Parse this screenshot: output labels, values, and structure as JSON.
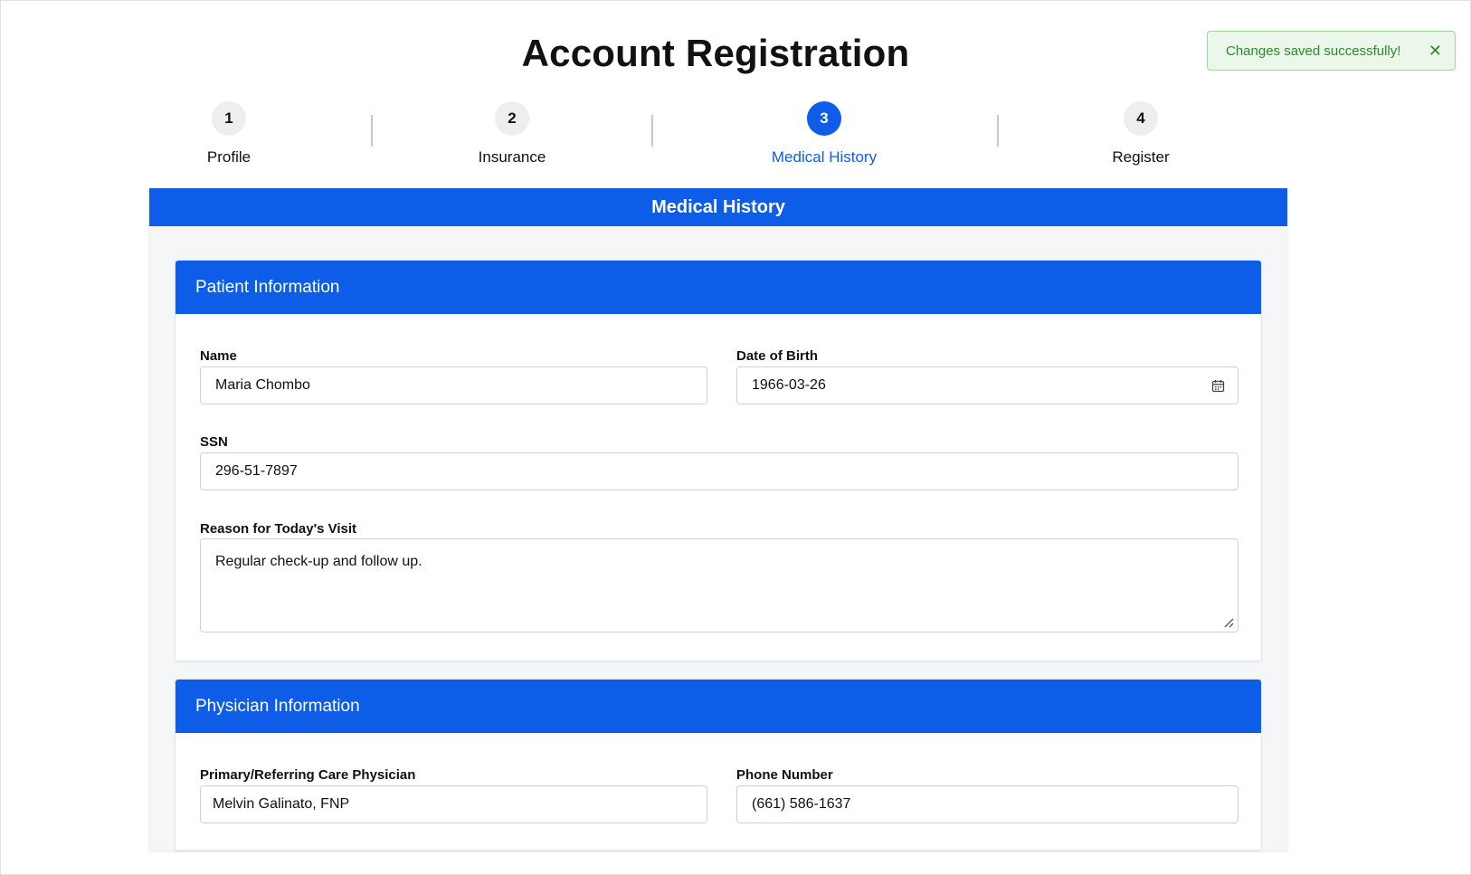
{
  "page": {
    "title": "Account Registration"
  },
  "toast": {
    "message": "Changes saved successfully!",
    "close_icon": "close-icon",
    "color": "#2c8a2c"
  },
  "steps": [
    {
      "number": "1",
      "label": "Profile",
      "active": false
    },
    {
      "number": "2",
      "label": "Insurance",
      "active": false
    },
    {
      "number": "3",
      "label": "Medical History",
      "active": true
    },
    {
      "number": "4",
      "label": "Register",
      "active": false
    }
  ],
  "accent_color": "#0d5de8",
  "section": {
    "title": "Medical History"
  },
  "patient": {
    "title": "Patient Information",
    "name_label": "Name",
    "name_value": "Maria Chombo",
    "dob_label": "Date of Birth",
    "dob_value": "1966-03-26",
    "dob_icon": "calendar-icon",
    "ssn_label": "SSN",
    "ssn_value": "296-51-7897",
    "reason_label": "Reason for Today's Visit",
    "reason_value": "Regular check-up and follow up."
  },
  "physician": {
    "title": "Physician Information",
    "physician_label": "Primary/Referring Care Physician",
    "physician_value": "Melvin Galinato, FNP",
    "phone_label": "Phone Number",
    "phone_value": "(661) 586-1637"
  }
}
